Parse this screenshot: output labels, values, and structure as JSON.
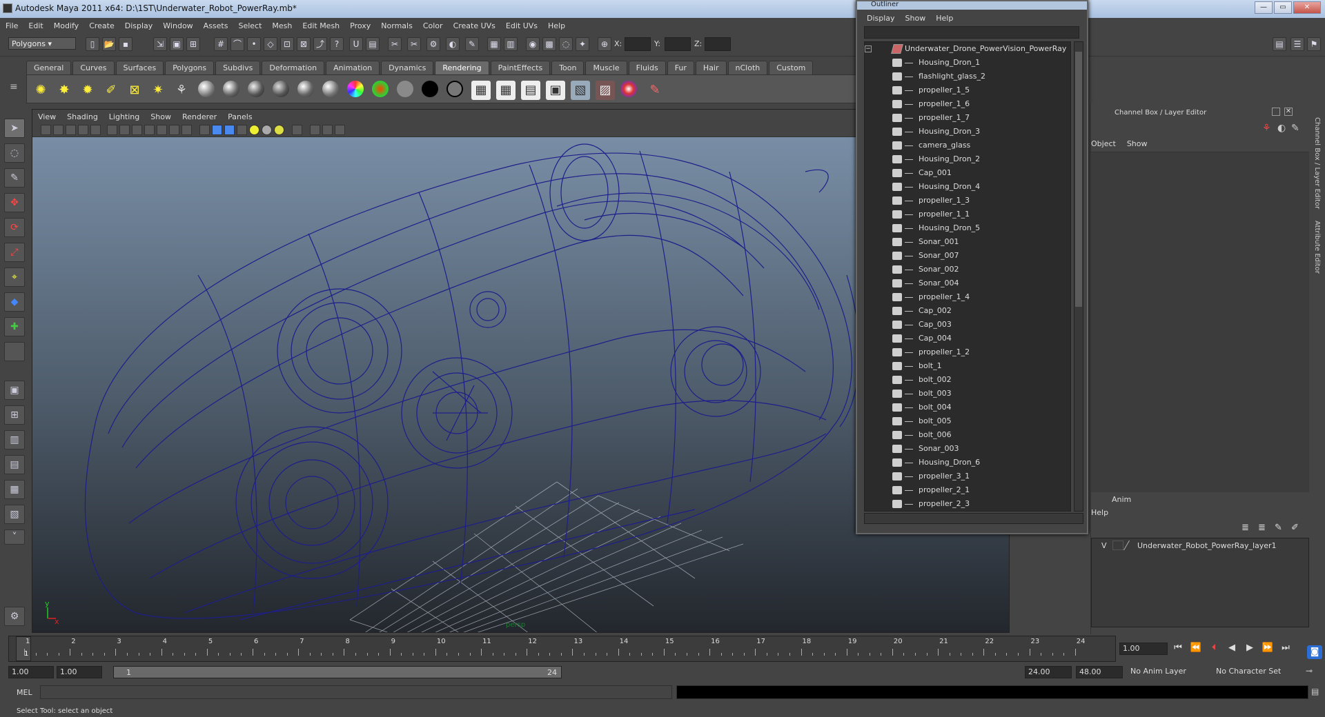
{
  "window": {
    "title": "Autodesk Maya 2011 x64: D:\\1ST\\Underwater_Robot_PowerRay.mb*"
  },
  "menubar": [
    "File",
    "Edit",
    "Modify",
    "Create",
    "Display",
    "Window",
    "Assets",
    "Select",
    "Mesh",
    "Edit Mesh",
    "Proxy",
    "Normals",
    "Color",
    "Create UVs",
    "Edit UVs",
    "Help"
  ],
  "toolbar": {
    "mode": "Polygons",
    "x_label": "X:",
    "y_label": "Y:",
    "z_label": "Z:"
  },
  "shelf_tabs": [
    "General",
    "Curves",
    "Surfaces",
    "Polygons",
    "Subdivs",
    "Deformation",
    "Animation",
    "Dynamics",
    "Rendering",
    "PaintEffects",
    "Toon",
    "Muscle",
    "Fluids",
    "Fur",
    "Hair",
    "nCloth",
    "Custom"
  ],
  "shelf_active": "Rendering",
  "viewport": {
    "menu": [
      "View",
      "Shading",
      "Lighting",
      "Show",
      "Renderer",
      "Panels"
    ],
    "camera_label": "persp",
    "axis_y": "y",
    "axis_x": "x"
  },
  "outliner": {
    "title": "Outliner",
    "menu": [
      "Display",
      "Show",
      "Help"
    ],
    "root": "Underwater_Drone_PowerVision_PowerRay",
    "items": [
      "Housing_Dron_1",
      "flashlight_glass_2",
      "propeller_1_5",
      "propeller_1_6",
      "propeller_1_7",
      "Housing_Dron_3",
      "camera_glass",
      "Housing_Dron_2",
      "Cap_001",
      "Housing_Dron_4",
      "propeller_1_3",
      "propeller_1_1",
      "Housing_Dron_5",
      "Sonar_001",
      "Sonar_007",
      "Sonar_002",
      "Sonar_004",
      "propeller_1_4",
      "Cap_002",
      "Cap_003",
      "Cap_004",
      "propeller_1_2",
      "bolt_1",
      "bolt_002",
      "bolt_003",
      "bolt_004",
      "bolt_005",
      "bolt_006",
      "Sonar_003",
      "Housing_Dron_6",
      "propeller_3_1",
      "propeller_2_1",
      "propeller_2_3"
    ]
  },
  "channel_box": {
    "header": "Channel Box / Layer Editor",
    "menu_object": "Object",
    "menu_show": "Show"
  },
  "layer_editor": {
    "tab_anim": "Anim",
    "help": "Help",
    "layer_visible": "V",
    "layer_name": "Underwater_Robot_PowerRay_layer1"
  },
  "side_tabs": {
    "channel": "Channel Box / Layer Editor",
    "attribute": "Attribute Editor"
  },
  "timeline": {
    "ticks": [
      "1",
      "2",
      "3",
      "4",
      "5",
      "6",
      "7",
      "8",
      "9",
      "10",
      "11",
      "12",
      "13",
      "14",
      "15",
      "16",
      "17",
      "18",
      "19",
      "20",
      "21",
      "22",
      "23",
      "24"
    ],
    "current_frame": "1",
    "current_field": "1.00"
  },
  "range": {
    "start": "1.00",
    "start2": "1.00",
    "slider_start": "1",
    "slider_end": "24",
    "end": "24.00",
    "end2": "48.00",
    "anim_layer": "No Anim Layer",
    "char_set": "No Character Set"
  },
  "mel": {
    "label": "MEL"
  },
  "status": {
    "text": "Select Tool: select an object"
  }
}
